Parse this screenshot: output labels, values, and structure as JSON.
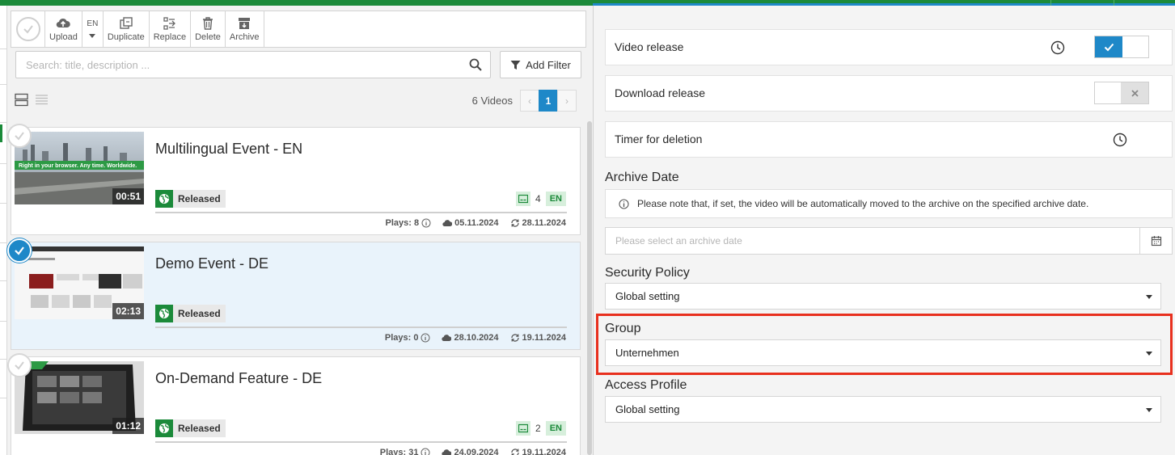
{
  "toolbar": {
    "upload_label": "Upload",
    "lang_label": "EN",
    "duplicate_label": "Duplicate",
    "replace_label": "Replace",
    "delete_label": "Delete",
    "archive_label": "Archive"
  },
  "search": {
    "placeholder": "Search: title, description ...",
    "add_filter_label": "Add Filter"
  },
  "list": {
    "count_label": "6 Videos",
    "page_prev": "‹",
    "page_current": "1",
    "page_next": "›"
  },
  "videos": [
    {
      "title": "Multilingual Event - EN",
      "duration": "00:51",
      "status": "Released",
      "subtitle_count": "4",
      "lang": "EN",
      "plays": "Plays: 8",
      "uploaded": "05.11.2024",
      "updated": "28.11.2024",
      "thumb_banner": "Right in your browser. Any time. Worldwide.",
      "selected": false
    },
    {
      "title": "Demo Event - DE",
      "duration": "02:13",
      "status": "Released",
      "plays": "Plays: 0",
      "uploaded": "28.10.2024",
      "updated": "19.11.2024",
      "selected": true
    },
    {
      "title": "On-Demand Feature - DE",
      "duration": "01:12",
      "status": "Released",
      "subtitle_count": "2",
      "lang": "EN",
      "plays": "Plays: 31",
      "uploaded": "24.09.2024",
      "updated": "19.11.2024",
      "selected": false
    }
  ],
  "settings": {
    "video_release_label": "Video release",
    "download_release_label": "Download release",
    "timer_label": "Timer for deletion",
    "archive_date_heading": "Archive Date",
    "archive_note": "Please note that, if set, the video will be automatically moved to the archive on the specified archive date.",
    "archive_placeholder": "Please select an archive date",
    "security_heading": "Security Policy",
    "security_value": "Global setting",
    "group_heading": "Group",
    "group_value": "Unternehmen",
    "access_heading": "Access Profile",
    "access_value": "Global setting"
  },
  "colors": {
    "brand_green": "#1b8a3a",
    "accent_blue": "#1e88c8",
    "highlight_red": "#e8301e"
  }
}
